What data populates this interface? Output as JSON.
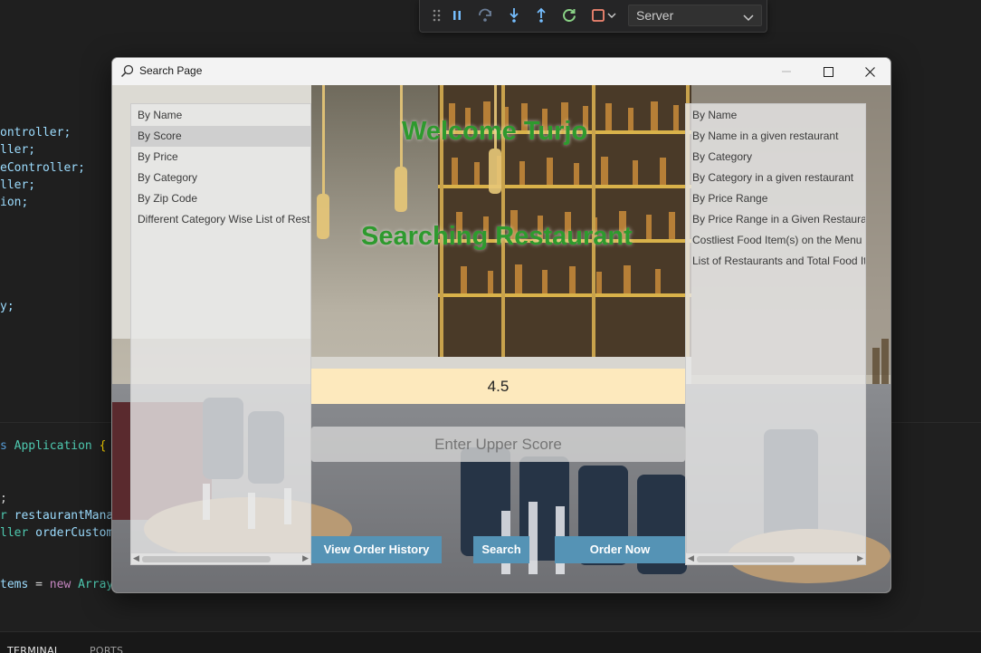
{
  "editor": {
    "code_lines": [
      {
        "text": "ontroller;",
        "cls": "c-var"
      },
      {
        "text": "ller;",
        "cls": "c-var"
      },
      {
        "text": "eController;",
        "cls": "c-var"
      },
      {
        "text": "ller;",
        "cls": "c-var"
      },
      {
        "text": "ion;",
        "cls": "c-var"
      },
      {
        "text": "y;",
        "cls": "c-var"
      }
    ],
    "class_decl": {
      "kw": "s",
      "type": "Application",
      "brace": "{"
    },
    "semi": ";",
    "field1": {
      "type": "r",
      "name": "restaurantMana"
    },
    "field2": {
      "type": "ller",
      "name": "orderCustom"
    },
    "items_line": {
      "name": "tems",
      "eq": "=",
      "new": "new",
      "type": "Array"
    },
    "panel_tabs": [
      "TERMINAL",
      "PORTS"
    ]
  },
  "debug_toolbar": {
    "target": "Server",
    "icons": [
      "drag-handle-icon",
      "pause-icon",
      "step-over-icon",
      "step-into-icon",
      "step-out-icon",
      "restart-icon",
      "stop-icon",
      "chevron-down-icon"
    ],
    "colors": {
      "pause": "#75beff",
      "restart": "#89d185",
      "stop": "#f48771"
    }
  },
  "window": {
    "title": "Search Page",
    "welcome": "Welcome Turjo",
    "heading": "Searching Restaurant",
    "left_list": {
      "items": [
        "By Name",
        "By Score",
        "By Price",
        "By Category",
        "By Zip Code",
        "Different Category Wise List of Resta"
      ],
      "selected_index": 1
    },
    "right_list": {
      "items": [
        "By Name",
        "By Name in a given restaurant",
        "By Category",
        "By Category in a given restaurant",
        "By Price Range",
        "By Price Range in a Given Restaurant",
        "Costliest Food Item(s) on the Menu i",
        "List of Restaurants and Total Food It"
      ]
    },
    "lower_score_value": "4.5",
    "upper_score_placeholder": "Enter Upper Score",
    "buttons": {
      "view_history": "View Order History",
      "search": "Search",
      "order_now": "Order Now"
    },
    "colors": {
      "heading": "#2e9a2e",
      "button": "#5593b5",
      "lower_field": "#fde9bd"
    }
  }
}
